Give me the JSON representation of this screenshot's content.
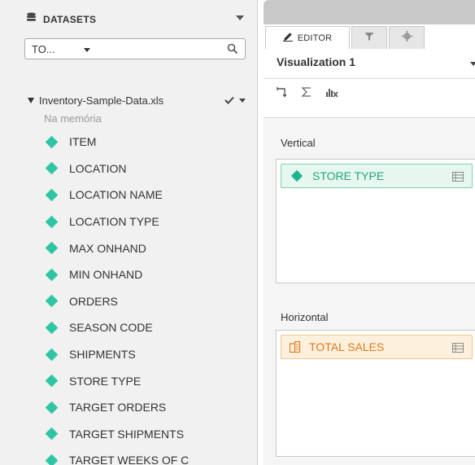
{
  "datasets_panel": {
    "title": "DATASETS",
    "source_select": {
      "value": "TO..."
    },
    "file": {
      "name": "Inventory-Sample-Data.xls",
      "status": "Na memória"
    },
    "fields": [
      "ITEM",
      "LOCATION",
      "LOCATION NAME",
      "LOCATION TYPE",
      "MAX ONHAND",
      "MIN ONHAND",
      "ORDERS",
      "SEASON CODE",
      "SHIPMENTS",
      "STORE TYPE",
      "TARGET ORDERS",
      "TARGET SHIPMENTS",
      "TARGET WEEKS OF C"
    ]
  },
  "editor_panel": {
    "tabs": [
      {
        "label": "EDITOR"
      }
    ],
    "visualization_title": "Visualization 1",
    "vertical": {
      "label": "Vertical",
      "pill": "STORE TYPE"
    },
    "horizontal": {
      "label": "Horizontal",
      "pill": "TOTAL SALES"
    }
  },
  "colors": {
    "attribute_accent": "#2ec5a5",
    "measure_accent": "#e07a1b",
    "panel_bg": "#f1f1f1"
  },
  "icons": [
    "database-icon",
    "search-icon",
    "check-icon",
    "pencil-icon",
    "filter-icon",
    "gear-icon",
    "swap-axes-icon",
    "sum-icon",
    "clear-chart-icon",
    "grid-icon",
    "measure-icon"
  ]
}
